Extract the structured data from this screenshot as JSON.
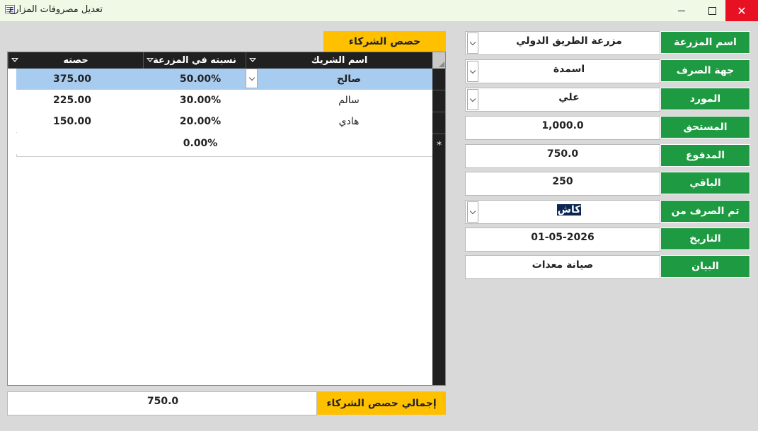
{
  "window": {
    "title": "تعديل مصروفات المزارع"
  },
  "form": {
    "fields": [
      {
        "label": "اسم المزرعة",
        "value": "مزرعة الطريق الدولي"
      },
      {
        "label": "جهة الصرف",
        "value": "اسمدة"
      },
      {
        "label": "المورد",
        "value": "علي"
      },
      {
        "label": "المستحق",
        "value": "1,000.0"
      },
      {
        "label": "المدفوع",
        "value": "750.0"
      },
      {
        "label": "الباقي",
        "value": "250"
      },
      {
        "label": "تم الصرف من",
        "value": "كاش"
      },
      {
        "label": "التاريخ",
        "value": "01-05-2026"
      },
      {
        "label": "البيان",
        "value": "صيانة معدات"
      }
    ]
  },
  "partners": {
    "section_title": "حصص الشركاء",
    "columns": {
      "name": "اسم الشريك",
      "percent": "نسبته في المزرعة",
      "share": "حصته"
    },
    "rows": [
      {
        "name": "صالح",
        "percent": "50.00%",
        "share": "375.00"
      },
      {
        "name": "سالم",
        "percent": "30.00%",
        "share": "225.00"
      },
      {
        "name": "هادي",
        "percent": "20.00%",
        "share": "150.00"
      }
    ],
    "new_row": {
      "percent": "0.00%",
      "marker": "*"
    },
    "total_label": "إجمالي حصص الشركاء",
    "total_value": "750.0"
  }
}
